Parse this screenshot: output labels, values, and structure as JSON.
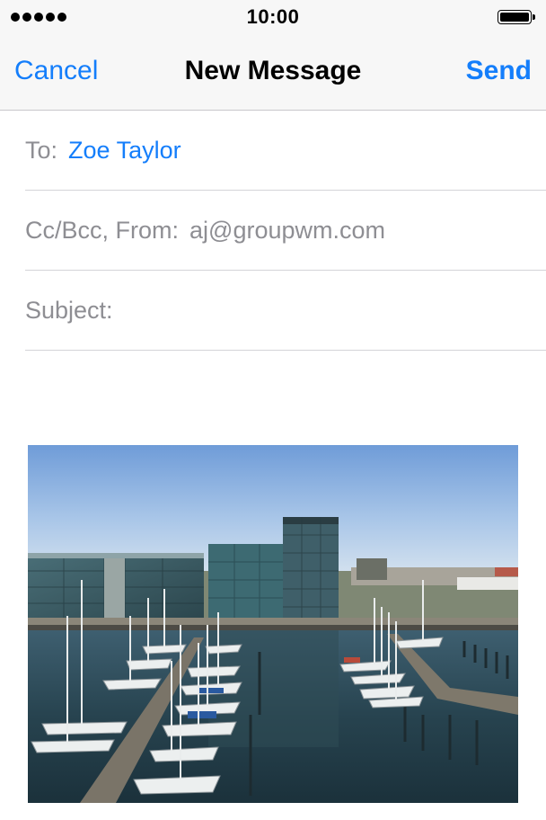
{
  "status_bar": {
    "time": "10:00",
    "signal_icon": "signal-dots-icon",
    "battery_icon": "battery-icon"
  },
  "nav": {
    "cancel_label": "Cancel",
    "title": "New Message",
    "send_label": "Send"
  },
  "fields": {
    "to_label": "To:",
    "to_value": "Zoe Taylor",
    "from_label": "Cc/Bcc, From:",
    "from_value": "aj@groupwm.com",
    "subject_label": "Subject:",
    "subject_value": ""
  },
  "attachment": {
    "type": "photo",
    "subject": "marina-harbor-photo"
  },
  "colors": {
    "accent": "#147efb",
    "secondary_text": "#8e8e93",
    "bar_background": "#f7f7f7"
  }
}
